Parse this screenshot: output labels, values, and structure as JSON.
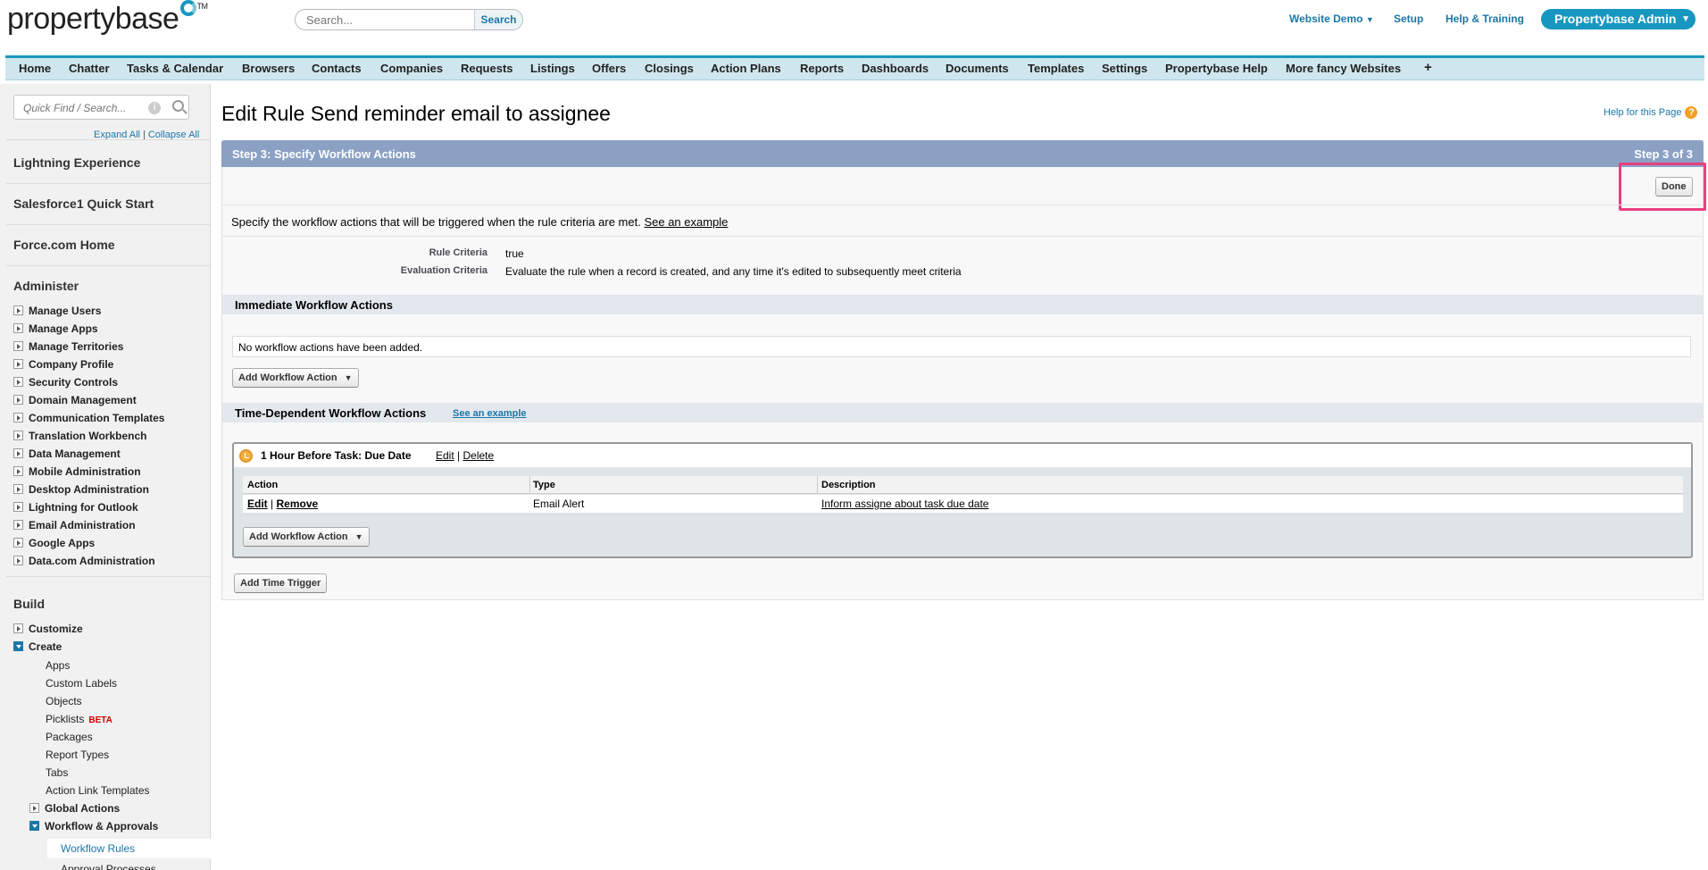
{
  "header": {
    "logo_text": "propertybase",
    "logo_tm": "TM",
    "search_placeholder": "Search...",
    "search_button": "Search",
    "website_demo": "Website Demo",
    "setup": "Setup",
    "help_training": "Help & Training",
    "user_menu": "Propertybase Admin"
  },
  "tabs": [
    "Home",
    "Chatter",
    "Tasks & Calendar",
    "Browsers",
    "Contacts",
    "Companies",
    "Requests",
    "Listings",
    "Offers",
    "Closings",
    "Action Plans",
    "Reports",
    "Dashboards",
    "Documents",
    "Templates",
    "Settings",
    "Propertybase Help",
    "More fancy Websites",
    "+"
  ],
  "sidebar": {
    "quickfind_placeholder": "Quick Find / Search...",
    "expand_all": "Expand All",
    "collapse_all": "Collapse All",
    "sep": "|",
    "top_sections": [
      "Lightning Experience",
      "Salesforce1 Quick Start",
      "Force.com Home"
    ],
    "administer": {
      "title": "Administer",
      "items": [
        "Manage Users",
        "Manage Apps",
        "Manage Territories",
        "Company Profile",
        "Security Controls",
        "Domain Management",
        "Communication Templates",
        "Translation Workbench",
        "Data Management",
        "Mobile Administration",
        "Desktop Administration",
        "Lightning for Outlook",
        "Email Administration",
        "Google Apps",
        "Data.com Administration"
      ]
    },
    "build": {
      "title": "Build",
      "customize": "Customize",
      "create": "Create",
      "create_items": [
        "Apps",
        "Custom Labels",
        "Objects",
        "Picklists",
        "Packages",
        "Report Types",
        "Tabs",
        "Action Link Templates"
      ],
      "beta_label": "BETA",
      "global_actions": "Global Actions",
      "workflow_approvals": "Workflow & Approvals",
      "workflow_rules": "Workflow Rules",
      "approval_processes": "Approval Processes"
    }
  },
  "main": {
    "title": "Edit Rule Send reminder email to assignee",
    "help_link": "Help for this Page",
    "help_icon_glyph": "?",
    "step_title": "Step 3: Specify Workflow Actions",
    "step_count": "Step 3 of 3",
    "done_button": "Done",
    "intro_text": "Specify the workflow actions that will be triggered when the rule criteria are met.",
    "intro_link": "See an example",
    "criteria": [
      {
        "label": "Rule Criteria",
        "value": "true"
      },
      {
        "label": "Evaluation Criteria",
        "value": "Evaluate the rule when a record is created, and any time it's edited to subsequently meet criteria"
      }
    ],
    "immediate": {
      "title": "Immediate Workflow Actions",
      "empty_text": "No workflow actions have been added.",
      "add_button": "Add Workflow Action"
    },
    "time_dependent": {
      "title": "Time-Dependent Workflow Actions",
      "example_link": "See an example",
      "trigger": {
        "title": "1 Hour Before Task: Due Date",
        "edit": "Edit",
        "sep": "|",
        "delete": "Delete",
        "columns": [
          "Action",
          "Type",
          "Description"
        ],
        "row": {
          "edit": "Edit",
          "remove": "Remove",
          "type": "Email Alert",
          "description": "Inform assigne about task due date"
        },
        "add_button": "Add Workflow Action"
      },
      "add_time_trigger": "Add Time Trigger"
    }
  }
}
